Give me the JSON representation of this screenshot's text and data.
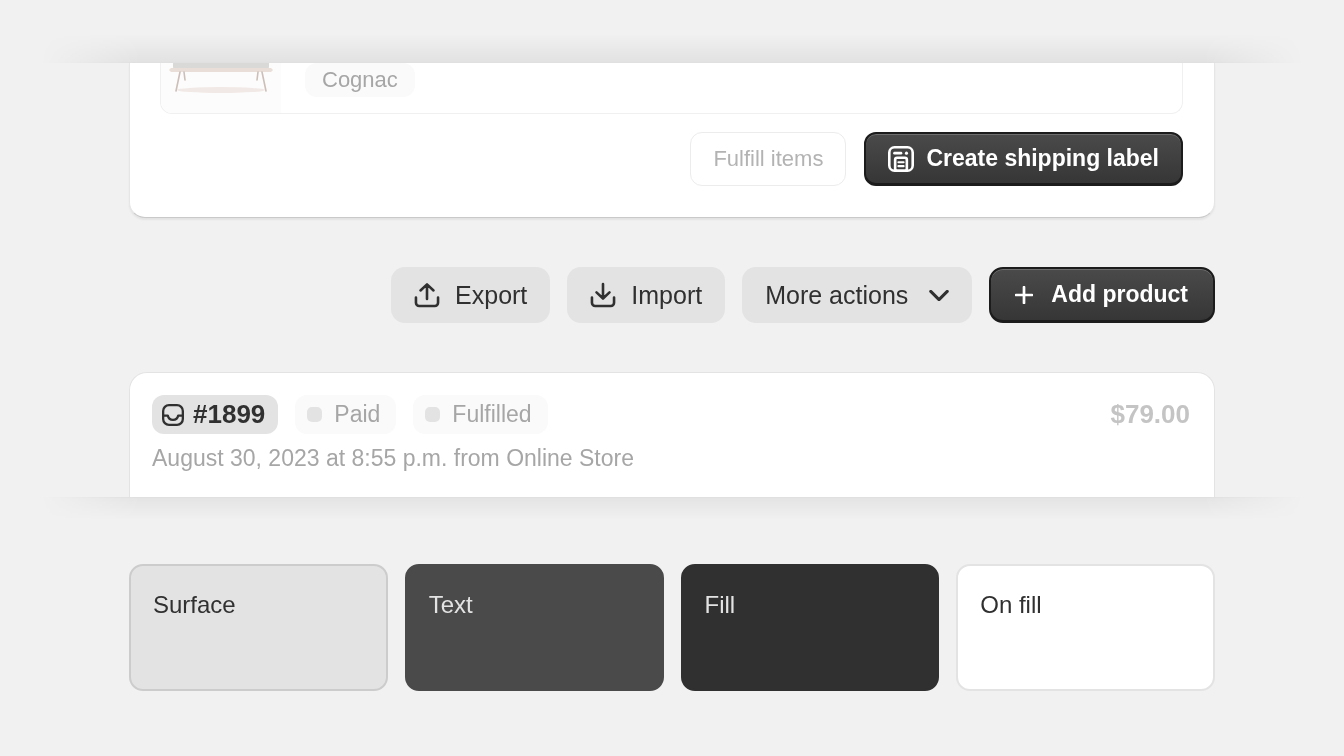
{
  "line_item": {
    "variant": {
      "label": "Cognac",
      "dimmed": true
    }
  },
  "fulfillment_actions": [
    {
      "label": "Fulfill items",
      "kind": "plain",
      "disabled": true
    },
    {
      "label": "Create shipping label",
      "kind": "label",
      "disabled": false
    }
  ],
  "toolbar": [
    {
      "label": "Export",
      "kind": "upload"
    },
    {
      "label": "Import",
      "kind": "download"
    },
    {
      "label": "More actions",
      "kind": "dropdown"
    },
    {
      "label": "Add product",
      "kind": "add"
    }
  ],
  "order": {
    "number": "#1899",
    "badges": [
      {
        "label": "Paid",
        "dimmed": true
      },
      {
        "label": "Fulfilled",
        "dimmed": true
      }
    ],
    "total": {
      "text": "$79.00",
      "dimmed": true
    },
    "meta": {
      "text": "August 30, 2023 at 8:55 p.m. from Online Store",
      "dimmed": true
    }
  },
  "swatches": [
    {
      "label": "Surface",
      "color": "#e3e3e3"
    },
    {
      "label": "Text",
      "color": "#4a4a4a"
    },
    {
      "label": "Fill",
      "color": "#303030"
    },
    {
      "label": "On fill",
      "color": "#ffffff"
    }
  ]
}
